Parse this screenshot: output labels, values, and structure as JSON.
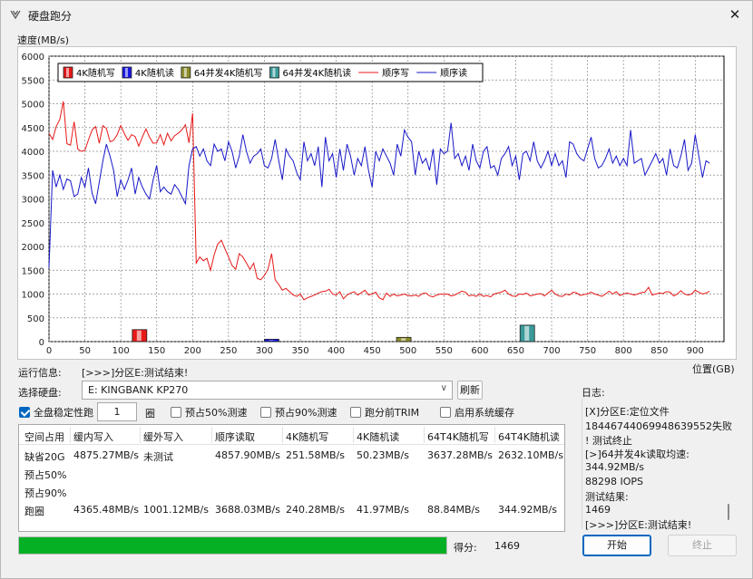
{
  "window": {
    "title": "硬盘跑分",
    "close_symbol": "✕"
  },
  "chart_header": {
    "ylabel": "速度(MB/s)",
    "xlabel": "位置(GB)"
  },
  "chart_data": {
    "type": "line",
    "ylabel": "速度(MB/s)",
    "xlabel": "位置(GB)",
    "xlim": [
      0,
      940
    ],
    "ylim": [
      0,
      6000
    ],
    "xticks": [
      0,
      50,
      100,
      150,
      200,
      250,
      300,
      350,
      400,
      450,
      500,
      550,
      600,
      650,
      700,
      750,
      800,
      850,
      900
    ],
    "yticks": [
      0,
      500,
      1000,
      1500,
      2000,
      2500,
      3000,
      3500,
      4000,
      4500,
      5000,
      5500,
      6000
    ],
    "grid": true,
    "legend_position": "top-left",
    "legend": [
      {
        "name": "4K随机写",
        "kind": "bar",
        "color": "#e81818"
      },
      {
        "name": "4K随机读",
        "kind": "bar",
        "color": "#1818e0"
      },
      {
        "name": "64并发4K随机写",
        "kind": "bar",
        "color": "#8c8c2a"
      },
      {
        "name": "64并发4K随机读",
        "kind": "bar",
        "color": "#3a9a9a"
      },
      {
        "name": "顺序写",
        "kind": "line",
        "color": "#e81818"
      },
      {
        "name": "顺序读",
        "kind": "line",
        "color": "#1818c8"
      }
    ],
    "bars": [
      {
        "series": "4K随机写",
        "x": 116,
        "value": 252,
        "color": "#e81818"
      },
      {
        "series": "4K随机读",
        "x": 300,
        "value": 50,
        "color": "#1818e0"
      },
      {
        "series": "64并发4K随机写",
        "x": 484,
        "value": 89,
        "color": "#8c8c2a"
      },
      {
        "series": "64并发4K随机读",
        "x": 656,
        "value": 345,
        "color": "#3a9a9a"
      }
    ],
    "series": [
      {
        "name": "顺序写",
        "color": "#e81818",
        "x": [
          0,
          5,
          10,
          15,
          20,
          25,
          30,
          35,
          40,
          45,
          50,
          55,
          60,
          65,
          70,
          75,
          80,
          85,
          90,
          95,
          100,
          105,
          110,
          115,
          120,
          125,
          130,
          135,
          140,
          145,
          150,
          155,
          160,
          165,
          170,
          175,
          180,
          185,
          190,
          195,
          200,
          205,
          210,
          215,
          220,
          225,
          230,
          235,
          240,
          245,
          250,
          255,
          260,
          265,
          270,
          275,
          280,
          285,
          290,
          295,
          300,
          305,
          310,
          315,
          320,
          325,
          330,
          335,
          340,
          345,
          350,
          355,
          360,
          365,
          370,
          375,
          380,
          385,
          390,
          395,
          400,
          405,
          410,
          415,
          420,
          425,
          430,
          435,
          440,
          445,
          450,
          455,
          460,
          465,
          470,
          475,
          480,
          485,
          490,
          495,
          500,
          505,
          510,
          515,
          520,
          525,
          530,
          535,
          540,
          545,
          550,
          555,
          560,
          565,
          570,
          575,
          580,
          585,
          590,
          595,
          600,
          605,
          610,
          615,
          620,
          625,
          630,
          635,
          640,
          645,
          650,
          655,
          660,
          665,
          670,
          675,
          680,
          685,
          690,
          695,
          700,
          705,
          710,
          715,
          720,
          725,
          730,
          735,
          740,
          745,
          750,
          755,
          760,
          765,
          770,
          775,
          780,
          785,
          790,
          795,
          800,
          805,
          810,
          815,
          820,
          825,
          830,
          835,
          840,
          845,
          850,
          855,
          860,
          865,
          870,
          875,
          880,
          885,
          890,
          895,
          900,
          905,
          910,
          915,
          920
        ],
        "values": [
          4380,
          4250,
          4520,
          4670,
          5050,
          4160,
          4130,
          4620,
          4050,
          4000,
          4020,
          4240,
          4450,
          4520,
          4170,
          4540,
          4480,
          4200,
          4230,
          4350,
          4540,
          4370,
          4230,
          4350,
          4310,
          4110,
          4300,
          4470,
          4300,
          4170,
          4180,
          4350,
          4140,
          4380,
          4220,
          4330,
          4380,
          4450,
          4560,
          4180,
          4800,
          1650,
          1780,
          1700,
          1750,
          1500,
          1820,
          2050,
          2130,
          1950,
          1780,
          1600,
          1520,
          1850,
          1780,
          1650,
          1520,
          1650,
          1330,
          1300,
          1390,
          1520,
          1850,
          1300,
          1200,
          1080,
          1120,
          1050,
          980,
          950,
          1000,
          880,
          920,
          950,
          980,
          1020,
          1050,
          1060,
          1100,
          1000,
          980,
          1050,
          900,
          980,
          1020,
          1050,
          980,
          1030,
          1080,
          980,
          1000,
          1040,
          920,
          880,
          1020,
          950,
          1000,
          960,
          980,
          1000,
          970,
          960,
          980,
          950,
          1010,
          1020,
          960,
          940,
          980,
          1000,
          990,
          1000,
          960,
          980,
          1020,
          1060,
          1040,
          960,
          980,
          950,
          1000,
          950,
          970,
          940,
          1000,
          1020,
          1040,
          1080,
          1000,
          960,
          950,
          1000,
          990,
          1020,
          960,
          980,
          1000,
          1010,
          960,
          1020,
          1080,
          1000,
          960,
          950,
          1000,
          980,
          1040,
          1020,
          970,
          990,
          1000,
          1040,
          1000,
          980,
          950,
          1000,
          1060,
          1000,
          1050,
          970,
          1000,
          1020,
          1000,
          980,
          1000,
          1030,
          1040,
          1140,
          980,
          1000,
          1020,
          1010,
          1050,
          1040,
          960,
          1000,
          1070,
          1000,
          980,
          1000,
          1080,
          1040,
          1000,
          1020,
          1060
        ]
      },
      {
        "name": "顺序读",
        "color": "#1818c8",
        "x": [
          0,
          5,
          10,
          15,
          20,
          25,
          30,
          35,
          40,
          45,
          50,
          55,
          60,
          65,
          70,
          75,
          80,
          85,
          90,
          95,
          100,
          105,
          110,
          115,
          120,
          125,
          130,
          135,
          140,
          145,
          150,
          155,
          160,
          165,
          170,
          175,
          180,
          185,
          190,
          195,
          200,
          205,
          210,
          215,
          220,
          225,
          230,
          235,
          240,
          245,
          250,
          255,
          260,
          265,
          270,
          275,
          280,
          285,
          290,
          295,
          300,
          305,
          310,
          315,
          320,
          325,
          330,
          335,
          340,
          345,
          350,
          355,
          360,
          365,
          370,
          375,
          380,
          385,
          390,
          395,
          400,
          405,
          410,
          415,
          420,
          425,
          430,
          435,
          440,
          445,
          450,
          455,
          460,
          465,
          470,
          475,
          480,
          485,
          490,
          495,
          500,
          505,
          510,
          515,
          520,
          525,
          530,
          535,
          540,
          545,
          550,
          555,
          560,
          565,
          570,
          575,
          580,
          585,
          590,
          595,
          600,
          605,
          610,
          615,
          620,
          625,
          630,
          635,
          640,
          645,
          650,
          655,
          660,
          665,
          670,
          675,
          680,
          685,
          690,
          695,
          700,
          705,
          710,
          715,
          720,
          725,
          730,
          735,
          740,
          745,
          750,
          755,
          760,
          765,
          770,
          775,
          780,
          785,
          790,
          795,
          800,
          805,
          810,
          815,
          820,
          825,
          830,
          835,
          840,
          845,
          850,
          855,
          860,
          865,
          870,
          875,
          880,
          885,
          890,
          895,
          900,
          905,
          910,
          915,
          920
        ],
        "values": [
          1550,
          3600,
          3250,
          3500,
          3200,
          3420,
          3380,
          3050,
          3100,
          3450,
          3250,
          3650,
          3120,
          2900,
          3350,
          3800,
          4150,
          3900,
          3600,
          3050,
          3400,
          3200,
          3400,
          3650,
          3100,
          3450,
          3250,
          3100,
          3000,
          3400,
          3700,
          3150,
          3250,
          3150,
          3100,
          3300,
          3200,
          3050,
          2900,
          3700,
          4050,
          4100,
          3900,
          4050,
          3800,
          3700,
          4150,
          4000,
          4050,
          3800,
          4200,
          4000,
          3650,
          3900,
          4350,
          4000,
          3750,
          3900,
          3950,
          4050,
          3700,
          3650,
          3850,
          4250,
          3800,
          3400,
          4050,
          3900,
          3800,
          3550,
          3400,
          4200,
          3800,
          3950,
          3700,
          4100,
          3250,
          4300,
          3800,
          3950,
          3450,
          4050,
          3600,
          4150,
          3900,
          3500,
          3850,
          3700,
          4100,
          3600,
          3250,
          4000,
          3800,
          4050,
          3900,
          3750,
          3500,
          4150,
          3900,
          4450,
          4300,
          4200,
          3500,
          4000,
          3750,
          3850,
          3600,
          4050,
          3300,
          4050,
          3950,
          4000,
          4600,
          3850,
          3950,
          3700,
          3900,
          3600,
          4150,
          3800,
          3650,
          4000,
          4100,
          3650,
          3700,
          3500,
          3850,
          3950,
          4100,
          3700,
          3900,
          3400,
          3950,
          4000,
          3800,
          4200,
          3800,
          3650,
          3800,
          4000,
          3700,
          3950,
          3700,
          3800,
          3450,
          4200,
          4150,
          3950,
          3850,
          3800,
          4050,
          4300,
          3850,
          3650,
          3700,
          3850,
          4050,
          3750,
          3900,
          3700,
          3850,
          3700,
          4450,
          3750,
          3800,
          3850,
          3500,
          3650,
          3800,
          3950,
          3750,
          3850,
          3500,
          4050,
          3700,
          3650,
          3900,
          4250,
          3600,
          3750,
          4350,
          3900,
          3450,
          3800,
          3750
        ]
      }
    ]
  },
  "run_info": {
    "label": "运行信息:",
    "value": "[>>>]分区E:测试结束!"
  },
  "disk": {
    "label": "选择硬盘:",
    "value": "E: KINGBANK KP270",
    "refresh": "刷新"
  },
  "log": {
    "label": "日志:",
    "lines": [
      "[X]分区E:定位文件",
      "18446744069948639552失败",
      "! 测试终止",
      "[>]64并发4k读取均速:",
      "344.92MB/s",
      "88298 IOPS",
      "测试结果:",
      "1469",
      "[>>>]分区E:测试结束!"
    ]
  },
  "options": {
    "full_stability": "全盘稳定性跑",
    "full_stability_checked": true,
    "laps_value": "1",
    "laps_unit": "圈",
    "pre50": "预占50%测速",
    "pre90": "预占90%测速",
    "trim": "跑分前TRIM",
    "cache": "启用系统缓存"
  },
  "table": {
    "headers": [
      "空间占用",
      "缓内写入",
      "缓外写入",
      "顺序读取",
      "4K随机写",
      "4K随机读",
      "64T4K随机写",
      "64T4K随机读"
    ],
    "rows": [
      [
        "缺省20G",
        "4875.27MB/s",
        "未测试",
        "4857.90MB/s",
        "251.58MB/s",
        "50.23MB/s",
        "3637.28MB/s",
        "2632.10MB/s"
      ],
      [
        "预占50%",
        "",
        "",
        "",
        "",
        "",
        "",
        ""
      ],
      [
        "预占90%",
        "",
        "",
        "",
        "",
        "",
        "",
        ""
      ],
      [
        "跑圈",
        "4365.48MB/s",
        "1001.12MB/s",
        "3688.03MB/s",
        "240.28MB/s",
        "41.97MB/s",
        "88.84MB/s",
        "344.92MB/s"
      ]
    ]
  },
  "progress": {
    "percent": 100
  },
  "score": {
    "label": "得分:",
    "value": "1469"
  },
  "buttons": {
    "start": "开始",
    "stop": "终止"
  },
  "colors": {
    "accent": "#0067c0",
    "progress": "#06b025",
    "write": "#e81818",
    "read": "#1818c8"
  }
}
